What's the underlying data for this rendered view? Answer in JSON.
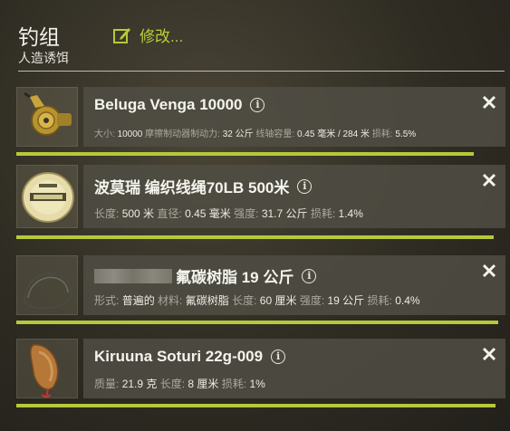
{
  "header": {
    "title": "钓组",
    "subtitle": "人造诱饵",
    "edit_label": "修改...",
    "accent": "#b5c93a"
  },
  "items": [
    {
      "name": "Beluga Venga 10000",
      "icon": "reel-icon",
      "stats": [
        {
          "label": "大小:",
          "value": "10000"
        },
        {
          "label": "摩擦制动器制动力:",
          "value": "32 公斤"
        },
        {
          "label": "线轴容量:",
          "value": "0.45 毫米 / 284 米"
        },
        {
          "label": "损耗:",
          "value": "5.5%"
        }
      ],
      "durability": 0.945
    },
    {
      "name": "波莫瑞 编织线绳70LB 500米",
      "icon": "line-spool-icon",
      "stats": [
        {
          "label": "长度:",
          "value": "500 米"
        },
        {
          "label": "直径:",
          "value": "0.45 毫米"
        },
        {
          "label": "强度:",
          "value": "31.7 公斤"
        },
        {
          "label": "损耗:",
          "value": "1.4%"
        }
      ],
      "durability": 0.986
    },
    {
      "name": "氟碳树脂 19 公斤",
      "icon": "leader-icon",
      "stats": [
        {
          "label": "形式:",
          "value": "普遍的"
        },
        {
          "label": "材料:",
          "value": "氟碳树脂"
        },
        {
          "label": "长度:",
          "value": "60 厘米"
        },
        {
          "label": "强度:",
          "value": "19 公斤"
        },
        {
          "label": "损耗:",
          "value": "0.4%"
        }
      ],
      "durability": 0.996
    },
    {
      "name": "Kiruuna Soturi 22g-009",
      "icon": "spoon-lure-icon",
      "stats": [
        {
          "label": "质量:",
          "value": "21.9 克"
        },
        {
          "label": "长度:",
          "value": "8 厘米"
        },
        {
          "label": "损耗:",
          "value": "1%"
        }
      ],
      "durability": 0.99
    }
  ]
}
